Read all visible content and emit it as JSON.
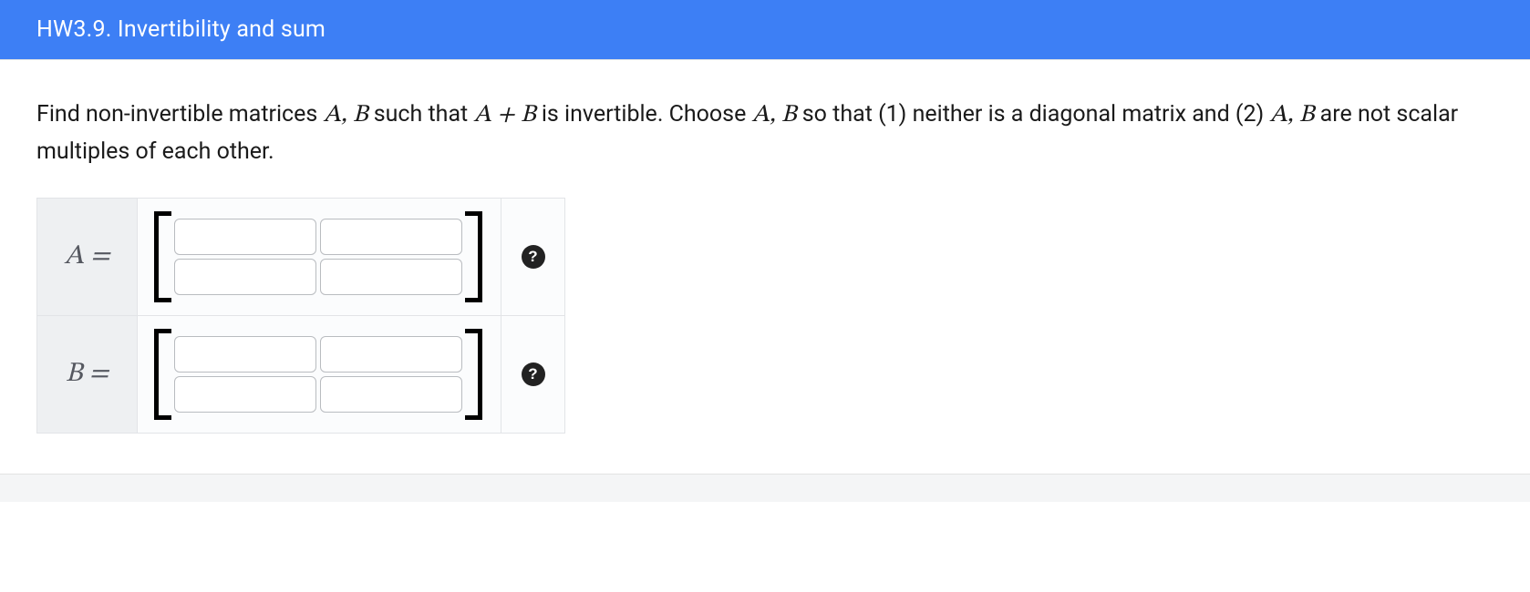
{
  "header": {
    "title": "HW3.9. Invertibility and sum"
  },
  "prompt": {
    "pre": "Find non-invertible matrices ",
    "AB1": "A, B",
    "mid1": " such that ",
    "AplusB": "A + B",
    "mid2": " is invertible. Choose ",
    "AB2": "A, B",
    "mid3": " so that (1) neither is a diagonal matrix and (2) ",
    "AB3": "A, B",
    "post": " are not scalar multiples of each other."
  },
  "matrices": {
    "A": {
      "label": "A =",
      "rows": 2,
      "cols": 2,
      "values": [
        [
          "",
          ""
        ],
        [
          "",
          ""
        ]
      ]
    },
    "B": {
      "label": "B =",
      "rows": 2,
      "cols": 2,
      "values": [
        [
          "",
          ""
        ],
        [
          "",
          ""
        ]
      ]
    }
  },
  "help_icon_glyph": "?"
}
